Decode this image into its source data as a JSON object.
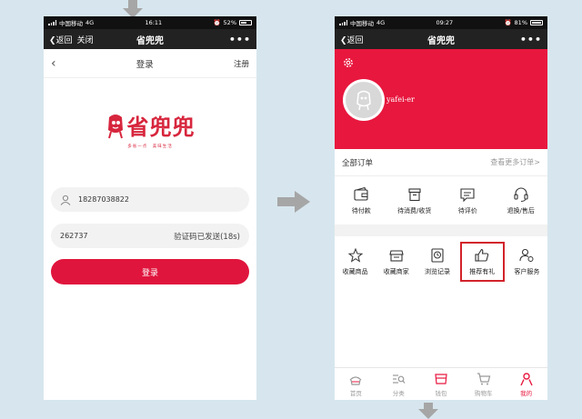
{
  "left_phone": {
    "status": {
      "carrier": "中国移动",
      "network": "4G",
      "time": "16:11",
      "battery": "52%"
    },
    "nav": {
      "back": "返回",
      "close": "关闭",
      "title": "省兜兜",
      "more": "•••"
    },
    "header": {
      "back_glyph": "‹",
      "title": "登录",
      "register": "注册"
    },
    "logo": {
      "text": "省兜兜",
      "slogan": "多省一点　美味生活"
    },
    "phone_input": {
      "value": "18287038822"
    },
    "code_input": {
      "value": "262737",
      "status": "验证码已发送(18s)"
    },
    "login_button": "登录"
  },
  "right_phone": {
    "status": {
      "carrier": "中国移动",
      "network": "4G",
      "time": "09:27",
      "battery": "81%"
    },
    "nav": {
      "back": "返回",
      "title": "省兜兜",
      "more": "•••"
    },
    "profile": {
      "username": "yafei-er"
    },
    "orders": {
      "title": "全部订单",
      "more": "查看更多订单>",
      "items": [
        {
          "label": "待付款",
          "icon": "wallet-icon"
        },
        {
          "label": "待消费/收货",
          "icon": "box-icon"
        },
        {
          "label": "待评价",
          "icon": "comment-icon"
        },
        {
          "label": "退换/售后",
          "icon": "headset-icon"
        }
      ]
    },
    "services": {
      "items": [
        {
          "label": "收藏商品",
          "icon": "star-icon"
        },
        {
          "label": "收藏商家",
          "icon": "shop-icon"
        },
        {
          "label": "浏览记录",
          "icon": "history-icon"
        },
        {
          "label": "推荐有礼",
          "icon": "thumbs-up-icon",
          "highlighted": true
        },
        {
          "label": "客户服务",
          "icon": "service-icon"
        }
      ]
    },
    "tabs": [
      {
        "label": "首页",
        "icon": "home-icon"
      },
      {
        "label": "分类",
        "icon": "category-icon"
      },
      {
        "label": "钱包",
        "icon": "wallet-icon"
      },
      {
        "label": "购物车",
        "icon": "cart-icon"
      },
      {
        "label": "我的",
        "icon": "profile-icon",
        "active": true
      }
    ]
  },
  "colors": {
    "accent": "#e8173e",
    "highlight_box": "#d2232a",
    "background": "#d7e6ee",
    "arrow": "#a6a6a6"
  }
}
